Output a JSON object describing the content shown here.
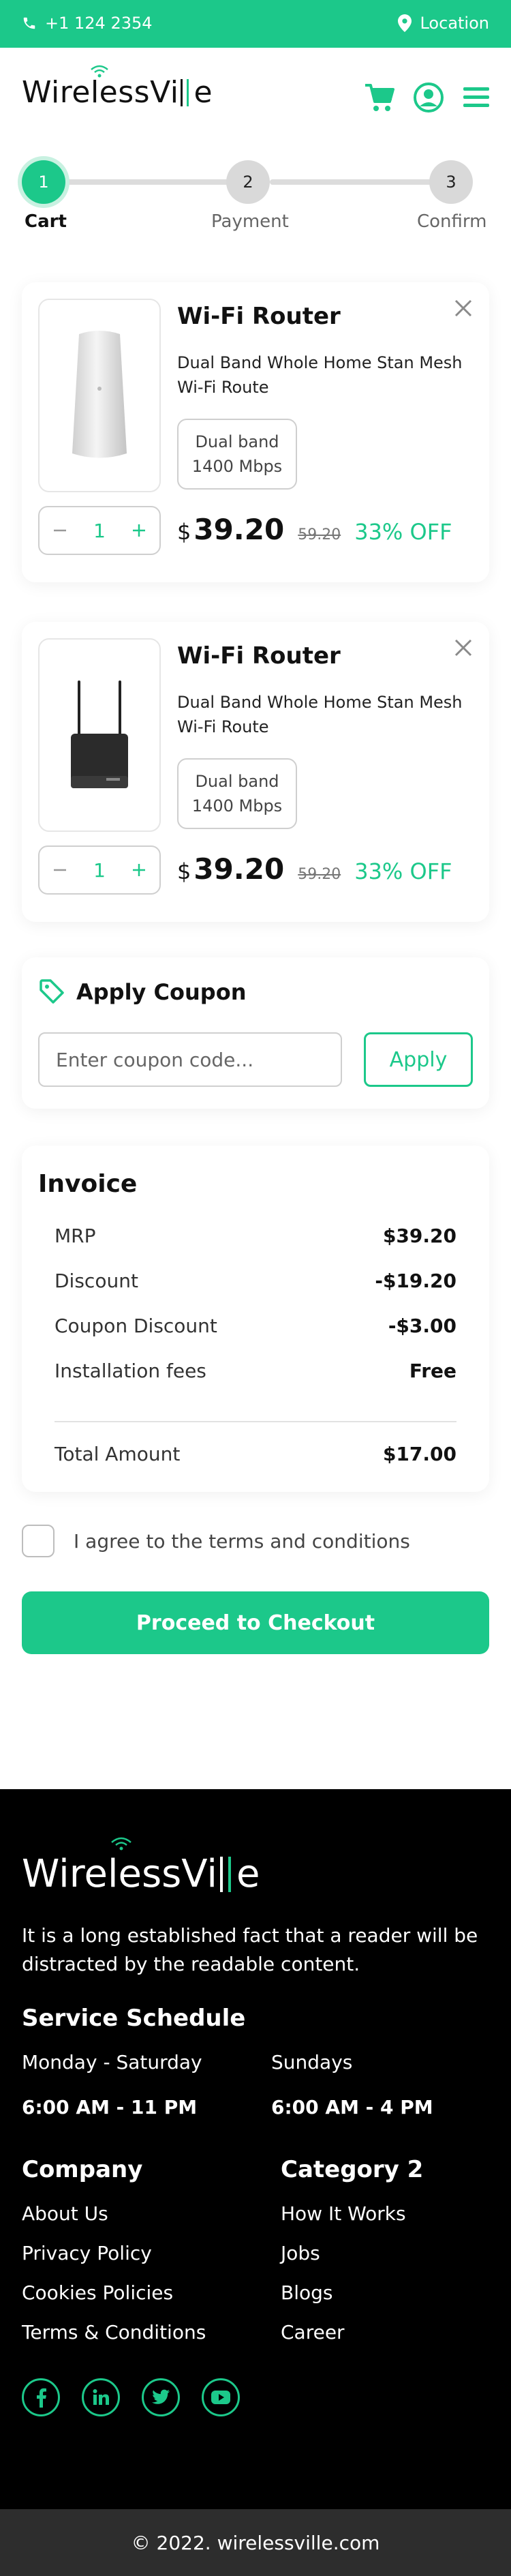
{
  "topbar": {
    "phone": "+1 124 2354",
    "location": "Location"
  },
  "brand": {
    "name_left": "WirelessVi",
    "name_right": "e"
  },
  "stepper": {
    "steps": [
      {
        "number": "1",
        "label": "Cart",
        "active": true
      },
      {
        "number": "2",
        "label": "Payment",
        "active": false
      },
      {
        "number": "3",
        "label": "Confirm",
        "active": false
      }
    ]
  },
  "cart": {
    "items": [
      {
        "title": "Wi-Fi Router",
        "description": "Dual Band Whole Home Stan Mesh Wi-Fi Route",
        "badge_line1": "Dual band",
        "badge_line2": "1400 Mbps",
        "quantity": "1",
        "currency": "$",
        "price": "39.20",
        "old_price": "59.20",
        "discount": "33% OFF"
      },
      {
        "title": "Wi-Fi Router",
        "description": "Dual Band Whole Home Stan Mesh Wi-Fi Route",
        "badge_line1": "Dual band",
        "badge_line2": "1400 Mbps",
        "quantity": "1",
        "currency": "$",
        "price": "39.20",
        "old_price": "59.20",
        "discount": "33% OFF"
      }
    ]
  },
  "coupon": {
    "title": "Apply Coupon",
    "placeholder": "Enter coupon code...",
    "button": "Apply"
  },
  "invoice": {
    "title": "Invoice",
    "rows": [
      {
        "label": "MRP",
        "value": "$39.20"
      },
      {
        "label": "Discount",
        "value": "-$19.20"
      },
      {
        "label": "Coupon Discount",
        "value": "-$3.00"
      },
      {
        "label": "Installation fees",
        "value": "Free"
      }
    ],
    "total_label": "Total Amount",
    "total_value": "$17.00"
  },
  "terms": {
    "label": "I agree to the terms and conditions"
  },
  "checkout": {
    "label": "Proceed to Checkout"
  },
  "footer": {
    "about": "It is a long established fact that a reader will be distracted by the readable content.",
    "schedule_title": "Service Schedule",
    "schedule": [
      {
        "days": "Monday - Saturday",
        "hours": "6:00 AM - 11 PM"
      },
      {
        "days": "Sundays",
        "hours": "6:00 AM - 4 PM"
      }
    ],
    "col1_title": "Company",
    "col1_links": [
      "About Us",
      "Privacy Policy",
      "Cookies Policies",
      "Terms & Conditions"
    ],
    "col2_title": "Category 2",
    "col2_links": [
      "How It Works",
      "Jobs",
      "Blogs",
      "Career"
    ],
    "socials": [
      "facebook-icon",
      "linkedin-icon",
      "twitter-icon",
      "youtube-icon"
    ],
    "copyright": "© 2022. wirelessville.com"
  },
  "colors": {
    "accent": "#1cc88a",
    "footer_bg": "#000000",
    "copyright_bg": "#2d2d2d"
  }
}
